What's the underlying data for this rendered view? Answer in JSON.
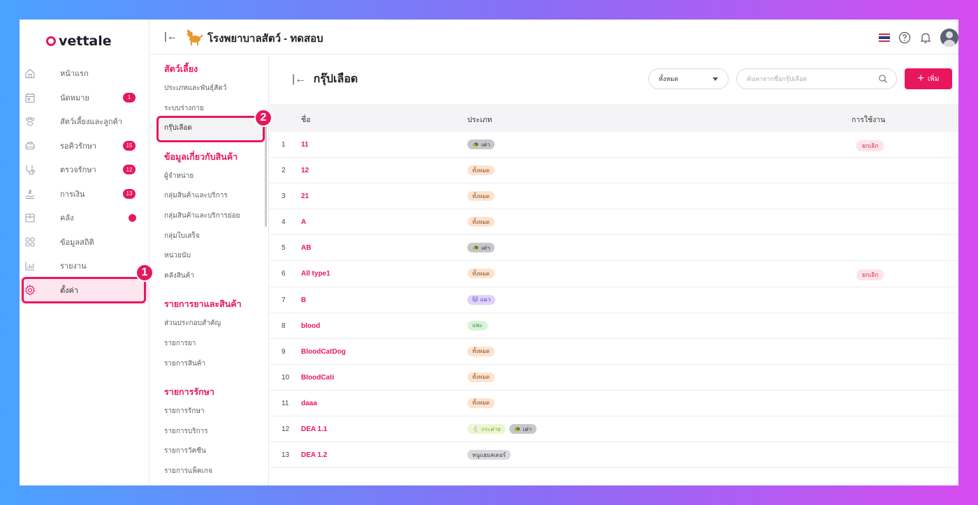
{
  "app": {
    "logo_text": "vettale"
  },
  "header": {
    "hospital_name": "โรงพยาบาลสัตว์ - ทดสอบ",
    "icons": [
      "collapse-icon",
      "dog-icon",
      "thai-flag-icon",
      "help-icon",
      "bell-icon",
      "avatar"
    ]
  },
  "sidebar": {
    "items": [
      {
        "label": "หน้าแรก",
        "icon": "home-icon",
        "badge": ""
      },
      {
        "label": "นัดหมาย",
        "icon": "calendar-icon",
        "badge": "1"
      },
      {
        "label": "สัตว์เลี้ยงและลูกค้า",
        "icon": "paw-icon",
        "badge": ""
      },
      {
        "label": "รอคิวรักษา",
        "icon": "queue-icon",
        "badge": "15"
      },
      {
        "label": "ตรวจรักษา",
        "icon": "stethoscope-icon",
        "badge": "12"
      },
      {
        "label": "การเงิน",
        "icon": "money-icon",
        "badge": "13"
      },
      {
        "label": "คลัง",
        "icon": "box-icon",
        "badge": "dot"
      },
      {
        "label": "ข้อมูลสถิติ",
        "icon": "stats-icon",
        "badge": ""
      },
      {
        "label": "รายงาน",
        "icon": "report-icon",
        "badge": ""
      },
      {
        "label": "ตั้งค่า",
        "icon": "gear-icon",
        "badge": "",
        "active": true
      }
    ]
  },
  "callouts": [
    "1",
    "2"
  ],
  "submenu": {
    "sections": [
      {
        "title": "สัตว์เลี้ยง",
        "items": [
          "ประเภทและพันธุ์สัตว์",
          "ระบบร่างกาย",
          "กรุ๊ปเลือด"
        ]
      },
      {
        "title": "ข้อมูลเกี่ยวกับสินค้า",
        "items": [
          "ผู้จำหน่าย",
          "กลุ่มสินค้าและบริการ",
          "กลุ่มสินค้าและบริการย่อย",
          "กลุ่มใบเสร็จ",
          "หน่วยนับ",
          "คลังสินค้า"
        ]
      },
      {
        "title": "รายการยาและสินค้า",
        "items": [
          "ส่วนประกอบสำคัญ",
          "รายการยา",
          "รายการสินค้า"
        ]
      },
      {
        "title": "รายการรักษา",
        "items": [
          "รายการรักษา",
          "รายการบริการ",
          "รายการวัคซีน",
          "รายการแพ็คเกจ"
        ]
      }
    ],
    "active_item": "กรุ๊ปเลือด"
  },
  "main": {
    "title": "กรุ๊ปเลือด",
    "filter_value": "ทั้งหมด",
    "search_placeholder": "ค้นหาจากชื่อกรุ๊ปเลือด",
    "add_label": "เพิ่ม",
    "columns": {
      "name": "ชื่อ",
      "type": "ประเภท",
      "usage": "การใช้งาน"
    }
  },
  "rows": [
    {
      "idx": "1",
      "name": "11",
      "types": [
        {
          "label": "เต่า",
          "kind": "turtle"
        }
      ],
      "status": "ยกเลิก"
    },
    {
      "idx": "2",
      "name": "12",
      "types": [
        {
          "label": "ทั้งหมด",
          "kind": "all"
        }
      ],
      "status": ""
    },
    {
      "idx": "3",
      "name": "21",
      "types": [
        {
          "label": "ทั้งหมด",
          "kind": "all"
        }
      ],
      "status": ""
    },
    {
      "idx": "4",
      "name": "A",
      "types": [
        {
          "label": "ทั้งหมด",
          "kind": "all"
        }
      ],
      "status": ""
    },
    {
      "idx": "5",
      "name": "AB",
      "types": [
        {
          "label": "เต่า",
          "kind": "turtle"
        }
      ],
      "status": ""
    },
    {
      "idx": "6",
      "name": "All type1",
      "types": [
        {
          "label": "ทั้งหมด",
          "kind": "all"
        }
      ],
      "status": "ยกเลิก"
    },
    {
      "idx": "7",
      "name": "B",
      "types": [
        {
          "label": "แมว",
          "kind": "cat"
        }
      ],
      "status": ""
    },
    {
      "idx": "8",
      "name": "blood",
      "types": [
        {
          "label": "แพะ",
          "kind": "sheep"
        }
      ],
      "status": ""
    },
    {
      "idx": "9",
      "name": "BloodCatDog",
      "types": [
        {
          "label": "ทั้งหมด",
          "kind": "all"
        }
      ],
      "status": ""
    },
    {
      "idx": "10",
      "name": "BloodCati",
      "types": [
        {
          "label": "ทั้งหมด",
          "kind": "all"
        }
      ],
      "status": ""
    },
    {
      "idx": "11",
      "name": "daaa",
      "types": [
        {
          "label": "ทั้งหมด",
          "kind": "all"
        }
      ],
      "status": ""
    },
    {
      "idx": "12",
      "name": "DEA 1.1",
      "types": [
        {
          "label": "กระต่าย",
          "kind": "rabbit"
        },
        {
          "label": "เต่า",
          "kind": "turtle"
        }
      ],
      "status": ""
    },
    {
      "idx": "13",
      "name": "DEA 1.2",
      "types": [
        {
          "label": "หนูแฮมสเตอร์",
          "kind": "misc"
        }
      ],
      "status": ""
    }
  ],
  "colors": {
    "accent": "#e8175d",
    "cancel_bg": "#fde4ea",
    "cancel_text": "#d0304d"
  }
}
